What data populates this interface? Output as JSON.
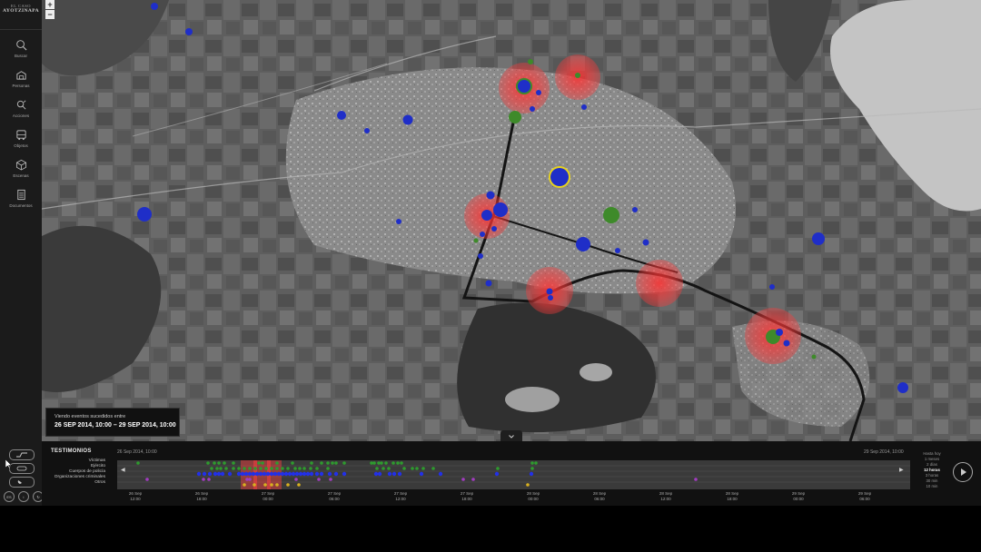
{
  "brand": {
    "line1": "EL CASO",
    "line2": "AYOTZINAPA"
  },
  "nav": [
    {
      "label": "Buscar",
      "icon": "search-icon"
    },
    {
      "label": "Personas",
      "icon": "people-icon"
    },
    {
      "label": "Acciones",
      "icon": "actions-icon"
    },
    {
      "label": "Objetos",
      "icon": "bus-icon"
    },
    {
      "label": "Escenas",
      "icon": "cube-icon"
    },
    {
      "label": "Documentos",
      "icon": "document-icon"
    }
  ],
  "map": {
    "zoom_in": "+",
    "zoom_out": "−",
    "colors": {
      "victims": "#2230c8",
      "army": "#3e8a2a",
      "police": "#2230c8",
      "zones": "#ff3a3a",
      "route": "#111111",
      "highlight": "#e6d21e"
    }
  },
  "range": {
    "title": "Viendo eventos sucedidos entre",
    "dates": "26 SEP 2014, 10:00 – 29 SEP 2014, 10:00"
  },
  "timeline": {
    "title": "TESTIMONIOS",
    "start": "26 Sep 2014, 10:00",
    "end": "29 Sep 2014, 10:00",
    "categories": [
      "Víctimas",
      "Ejército",
      "Cuerpos de policía",
      "Organizaciones criminales",
      "Otros"
    ],
    "category_colors": [
      "#2e9b2e",
      "#2e9b2e",
      "#2230e8",
      "#a23cc0",
      "#d8b020"
    ],
    "ticks": [
      {
        "day": "26 Sep",
        "time": "12:00"
      },
      {
        "day": "26 Sep",
        "time": "18:00"
      },
      {
        "day": "27 Sep",
        "time": "00:00"
      },
      {
        "day": "27 Sep",
        "time": "06:00"
      },
      {
        "day": "27 Sep",
        "time": "12:00"
      },
      {
        "day": "27 Sep",
        "time": "18:00"
      },
      {
        "day": "28 Sep",
        "time": "00:00"
      },
      {
        "day": "28 Sep",
        "time": "06:00"
      },
      {
        "day": "28 Sep",
        "time": "12:00"
      },
      {
        "day": "28 Sep",
        "time": "18:00"
      },
      {
        "day": "29 Sep",
        "time": "00:00"
      },
      {
        "day": "29 Sep",
        "time": "06:00"
      }
    ],
    "zoom_levels": [
      "Hasta hoy",
      "1 meses",
      "2 días",
      "12 horas",
      "3 horas",
      "30 min",
      "10 min"
    ],
    "zoom_active": "12 horas"
  },
  "controls": {
    "info": "i",
    "lang": "ES"
  }
}
